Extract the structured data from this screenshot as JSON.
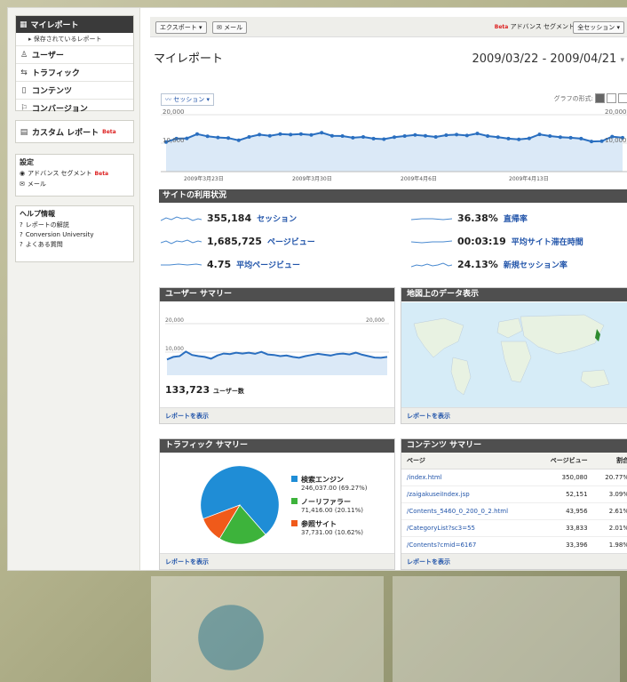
{
  "sidebar": {
    "my_report": "マイレポート",
    "saved_reports": "▸ 保存されているレポート",
    "items": [
      {
        "label": "ユーザー",
        "icon": "user-icon"
      },
      {
        "label": "トラフィック",
        "icon": "traffic-icon"
      },
      {
        "label": "コンテンツ",
        "icon": "content-icon"
      },
      {
        "label": "コンバージョン",
        "icon": "flag-icon"
      }
    ],
    "custom_report": "カスタム レポート",
    "beta": "Beta",
    "settings": {
      "title": "設定",
      "advanced_segment": "アドバンス セグメント",
      "email": "メール"
    },
    "help": {
      "title": "ヘルプ情報",
      "links": [
        "レポートの解説",
        "Conversion University",
        "よくある質問"
      ]
    }
  },
  "toolbar": {
    "export_label": "エクスポート ▾",
    "email_label": "メール",
    "beta": "Beta",
    "advanced_segment": "アドバンス セグメント",
    "segment_select": "全セッション ▾"
  },
  "header": {
    "title": "マイレポート",
    "date_range": "2009/03/22 - 2009/04/21"
  },
  "graph": {
    "metric_select": "セッション ▾",
    "graph_type_label": "グラフの形式:",
    "y_max": "20,000",
    "y_mid": "10,000",
    "x_ticks": [
      "2009年3月23日",
      "2009年3月30日",
      "2009年4月6日",
      "2009年4月13日"
    ]
  },
  "usage": {
    "title": "サイトの利用状況",
    "metrics": [
      {
        "value": "355,184",
        "label": "セッション"
      },
      {
        "value": "1,685,725",
        "label": "ページビュー"
      },
      {
        "value": "4.75",
        "label": "平均ページビュー"
      },
      {
        "value": "36.38%",
        "label": "直帰率"
      },
      {
        "value": "00:03:19",
        "label": "平均サイト滞在時間"
      },
      {
        "value": "24.13%",
        "label": "新規セッション率"
      }
    ]
  },
  "user_summary": {
    "title": "ユーザー サマリー",
    "y_max_left": "20,000",
    "y_max_right": "20,000",
    "y_mid": "10,000",
    "total": "133,723",
    "total_label": "ユーザー数",
    "footer": "レポートを表示"
  },
  "map": {
    "title": "地図上のデータ表示",
    "footer": "レポートを表示"
  },
  "traffic_summary": {
    "title": "トラフィック サマリー",
    "footer": "レポートを表示",
    "legend": [
      {
        "name": "検索エンジン",
        "detail": "246,037.00 (69.27%)",
        "color": "#1f8dd6"
      },
      {
        "name": "ノーリファラー",
        "detail": "71,416.00 (20.11%)",
        "color": "#3db33b"
      },
      {
        "name": "参照サイト",
        "detail": "37,731.00 (10.62%)",
        "color": "#f05a1a"
      }
    ]
  },
  "content_summary": {
    "title": "コンテンツ サマリー",
    "columns": [
      "ページ",
      "ページビュー",
      "割合"
    ],
    "rows": [
      [
        "/index.html",
        "350,080",
        "20.77%"
      ],
      [
        "/zaigakuseiIndex.jsp",
        "52,151",
        "3.09%"
      ],
      [
        "/Contents_5460_0_200_0_2.html",
        "43,956",
        "2.61%"
      ],
      [
        "/CategoryList?sc3=55",
        "33,833",
        "2.01%"
      ],
      [
        "/Contents?cmid=6167",
        "33,396",
        "1.98%"
      ]
    ],
    "footer": "レポートを表示"
  },
  "chart_data": [
    {
      "type": "line",
      "title": "",
      "series": [
        {
          "name": "セッション",
          "values": [
            10400,
            11600,
            11700,
            13200,
            12400,
            12000,
            11800,
            11000,
            12200,
            13000,
            12600,
            13200,
            13000,
            13200,
            12900,
            13700,
            12600,
            12500,
            11900,
            12200,
            11600,
            11400,
            12100,
            12500,
            12900,
            12600,
            12200,
            12800,
            13000,
            12700,
            13400,
            12500,
            12100,
            11600,
            11300,
            11700,
            13100,
            12500,
            12100,
            11900,
            11600,
            10600,
            10700,
            12300,
            11900
          ]
        }
      ],
      "ylim": [
        0,
        20000
      ]
    },
    {
      "type": "line",
      "title": "",
      "series": [
        {
          "name": "ユーザー数",
          "values": [
            7400,
            8300,
            8600,
            10200,
            9000,
            8600,
            8300,
            7700,
            8800,
            9500,
            9300,
            9800,
            9500,
            9800,
            9400,
            10100,
            9200,
            9000,
            8600,
            8800,
            8300,
            8000,
            8600,
            9000,
            9400,
            9100,
            8800,
            9300,
            9500,
            9200,
            9800,
            9100,
            8600,
            8100,
            8000,
            8300
          ]
        }
      ],
      "ylim": [
        0,
        20000
      ]
    },
    {
      "type": "pie",
      "title": "",
      "categories": [
        "検索エンジン",
        "ノーリファラー",
        "参照サイト"
      ],
      "values": [
        246037,
        71416,
        37731
      ]
    }
  ]
}
